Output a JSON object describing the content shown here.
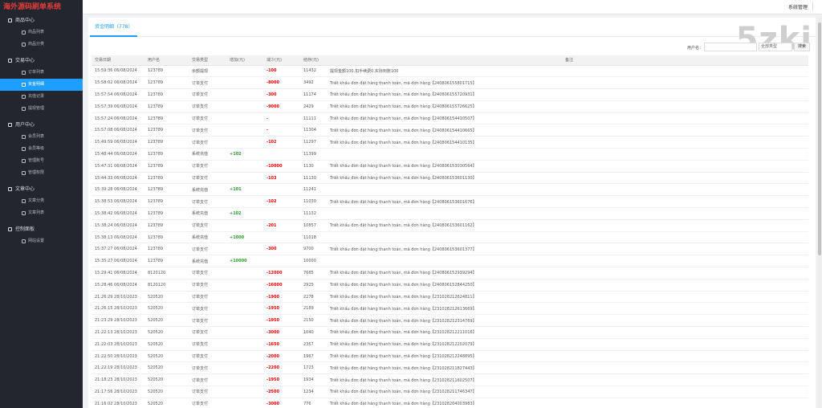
{
  "brand": "海外源码刷单系统",
  "sidebar": [
    {
      "label": "商品中心",
      "icon": "grid-icon",
      "items": [
        {
          "label": "商品列表"
        },
        {
          "label": "商品分类"
        }
      ]
    },
    {
      "label": "交易中心",
      "icon": "refresh-icon",
      "items": [
        {
          "label": "订单列表"
        },
        {
          "label": "资金明细",
          "active": true
        },
        {
          "label": "充值记录"
        },
        {
          "label": "提现管理"
        }
      ]
    },
    {
      "label": "用户中心",
      "icon": "user-icon",
      "items": [
        {
          "label": "会员列表"
        },
        {
          "label": "会员等级"
        },
        {
          "label": "管理账号"
        },
        {
          "label": "管理权限"
        }
      ]
    },
    {
      "label": "文章中心",
      "icon": "doc-icon",
      "items": [
        {
          "label": "文章分类"
        },
        {
          "label": "文章列表"
        }
      ]
    },
    {
      "label": "控制面板",
      "icon": "gear-icon",
      "items": [
        {
          "label": "网站设置"
        }
      ]
    }
  ],
  "header": {
    "system": "系统管理"
  },
  "tab": {
    "label": "资金明细（778）"
  },
  "watermark": "5zki",
  "search": {
    "label": "用户名：",
    "select": "全部类型",
    "button": "搜索"
  },
  "columns": [
    "交易日期",
    "用户名",
    "交易类型",
    "增加(元)",
    "减少(元)",
    "结存(元)",
    "备注"
  ],
  "rows": [
    {
      "date": "15:59:36 06/08/2024",
      "user": "123789",
      "type": "余额提现",
      "inc": "",
      "dec": "-100",
      "bal": "11432",
      "note": "提现金额100,扣手续费0,实际到账100"
    },
    {
      "date": "15:58:02 06/08/2024",
      "user": "123789",
      "type": "订单支付",
      "inc": "",
      "dec": "-8000",
      "bal": "3492",
      "note": "Triết khấu đơn đặt hàng thanh toán, mã đơn hàng【240806155801715】"
    },
    {
      "date": "15:57:54 06/08/2024",
      "user": "123789",
      "type": "订单支付",
      "inc": "",
      "dec": "-300",
      "bal": "11174",
      "note": "Triết khấu đơn đặt hàng thanh toán, mã đơn hàng【240806155720931】"
    },
    {
      "date": "15:57:39 06/08/2024",
      "user": "123789",
      "type": "订单支付",
      "inc": "",
      "dec": "-9000",
      "bal": "2429",
      "note": "Triết khấu đơn đặt hàng thanh toán, mã đơn hàng【240806155726625】"
    },
    {
      "date": "15:57:24 06/08/2024",
      "user": "123789",
      "type": "订单支付",
      "inc": "",
      "dec": "-",
      "bal": "11111",
      "note": "Triết khấu đơn đặt hàng thanh toán, mã đơn hàng【240806154410507】"
    },
    {
      "date": "15:57:08 06/08/2024",
      "user": "123789",
      "type": "订单支付",
      "inc": "",
      "dec": "-",
      "bal": "11304",
      "note": "Triết khấu đơn đặt hàng thanh toán, mã đơn hàng【240806154410665】"
    },
    {
      "date": "15:49:59 06/08/2024",
      "user": "123789",
      "type": "订单支付",
      "inc": "",
      "dec": "-102",
      "bal": "11297",
      "note": "Triết khấu đơn đặt hàng thanh toán, mã đơn hàng【240806154410135】"
    },
    {
      "date": "15:48:44 06/08/2024",
      "user": "123789",
      "type": "系统充值",
      "inc": "+102",
      "dec": "",
      "bal": "11399",
      "note": ""
    },
    {
      "date": "15:47:31 06/08/2024",
      "user": "123789",
      "type": "订单支付",
      "inc": "",
      "dec": "-10000",
      "bal": "1130",
      "note": "Triết khấu đơn đặt hàng thanh toán, mã đơn hàng【240806153030564】"
    },
    {
      "date": "15:44:33 06/08/2024",
      "user": "123789",
      "type": "订单支付",
      "inc": "",
      "dec": "-103",
      "bal": "11130",
      "note": "Triết khấu đơn đặt hàng thanh toán, mã đơn hàng【240806153601130】"
    },
    {
      "date": "15:39:28 06/08/2024",
      "user": "123789",
      "type": "系统充值",
      "inc": "+101",
      "dec": "",
      "bal": "11241",
      "note": ""
    },
    {
      "date": "15:38:53 06/08/2024",
      "user": "123789",
      "type": "订单支付",
      "inc": "",
      "dec": "-102",
      "bal": "11030",
      "note": "Triết khấu đơn đặt hàng thanh toán, mã đơn hàng【240806153601676】"
    },
    {
      "date": "15:38:42 06/08/2024",
      "user": "123789",
      "type": "系统充值",
      "inc": "+102",
      "dec": "",
      "bal": "11132",
      "note": ""
    },
    {
      "date": "15:38:24 06/08/2024",
      "user": "123789",
      "type": "订单支付",
      "inc": "",
      "dec": "-201",
      "bal": "10857",
      "note": "Triết khấu đơn đặt hàng thanh toán, mã đơn hàng【240806153601162】"
    },
    {
      "date": "15:38:13 06/08/2024",
      "user": "123789",
      "type": "系统充值",
      "inc": "+1000",
      "dec": "",
      "bal": "11018",
      "note": ""
    },
    {
      "date": "15:37:27 06/08/2024",
      "user": "123789",
      "type": "订单支付",
      "inc": "",
      "dec": "-300",
      "bal": "9700",
      "note": "Triết khấu đơn đặt hàng thanh toán, mã đơn hàng【240806153601377】"
    },
    {
      "date": "15:35:27 06/08/2024",
      "user": "123789",
      "type": "系统充值",
      "inc": "+10000",
      "dec": "",
      "bal": "10000",
      "note": ""
    },
    {
      "date": "15:29:41 06/08/2024",
      "user": "8120120",
      "type": "订单支付",
      "inc": "",
      "dec": "-12000",
      "bal": "7685",
      "note": "Triết khấu đơn đặt hàng thanh toán, mã đơn hàng【240806152939294】"
    },
    {
      "date": "15:28:46 06/08/2024",
      "user": "8120120",
      "type": "订单支付",
      "inc": "",
      "dec": "-16000",
      "bal": "2925",
      "note": "Triết khấu đơn đặt hàng thanh toán, mã đơn hàng【240806152844250】"
    },
    {
      "date": "21:26:29 28/10/2023",
      "user": "520520",
      "type": "订单支付",
      "inc": "",
      "dec": "-1900",
      "bal": "2278",
      "note": "Triết khấu đơn đặt hàng thanh toán, mã đơn hàng【231028212624811】"
    },
    {
      "date": "21:26:15 28/10/2023",
      "user": "520520",
      "type": "订单支付",
      "inc": "",
      "dec": "-1950",
      "bal": "2189",
      "note": "Triết khấu đơn đặt hàng thanh toán, mã đơn hàng【231028212613669】"
    },
    {
      "date": "21:23:29 28/10/2023",
      "user": "520520",
      "type": "订单支付",
      "inc": "",
      "dec": "-1950",
      "bal": "2150",
      "note": "Triết khấu đơn đặt hàng thanh toán, mã đơn hàng【231028212314769】"
    },
    {
      "date": "21:22:13 28/10/2023",
      "user": "520520",
      "type": "订单支付",
      "inc": "",
      "dec": "-3000",
      "bal": "1040",
      "note": "Triết khấu đơn đặt hàng thanh toán, mã đơn hàng【231028212211016】"
    },
    {
      "date": "21:22:03 28/10/2023",
      "user": "520520",
      "type": "订单支付",
      "inc": "",
      "dec": "-1650",
      "bal": "2357",
      "note": "Triết khấu đơn đặt hàng thanh toán, mã đơn hàng【231028212202079】"
    },
    {
      "date": "21:22:50 28/10/2023",
      "user": "520520",
      "type": "订单支付",
      "inc": "",
      "dec": "-2000",
      "bal": "1967",
      "note": "Triết khấu đơn đặt hàng thanh toán, mã đơn hàng【231028212248895】"
    },
    {
      "date": "21:22:19 28/10/2023",
      "user": "520520",
      "type": "订单支付",
      "inc": "",
      "dec": "-2200",
      "bal": "1723",
      "note": "Triết khấu đơn đặt hàng thanh toán, mã đơn hàng【231028211827443】"
    },
    {
      "date": "21:18:23 28/10/2023",
      "user": "520520",
      "type": "订单支付",
      "inc": "",
      "dec": "-1950",
      "bal": "1934",
      "note": "Triết khấu đơn đặt hàng thanh toán, mã đơn hàng【231028211602507】"
    },
    {
      "date": "21:17:56 28/10/2023",
      "user": "520520",
      "type": "订单支付",
      "inc": "",
      "dec": "-2500",
      "bal": "1234",
      "note": "Triết khấu đơn đặt hàng thanh toán, mã đơn hàng【231028211746347】"
    },
    {
      "date": "21:16:02 28/10/2023",
      "user": "520520",
      "type": "订单支付",
      "inc": "",
      "dec": "-3000",
      "bal": "776",
      "note": "Triết khấu đơn đặt hàng thanh toán, mã đơn hàng【231028204003983】"
    }
  ]
}
